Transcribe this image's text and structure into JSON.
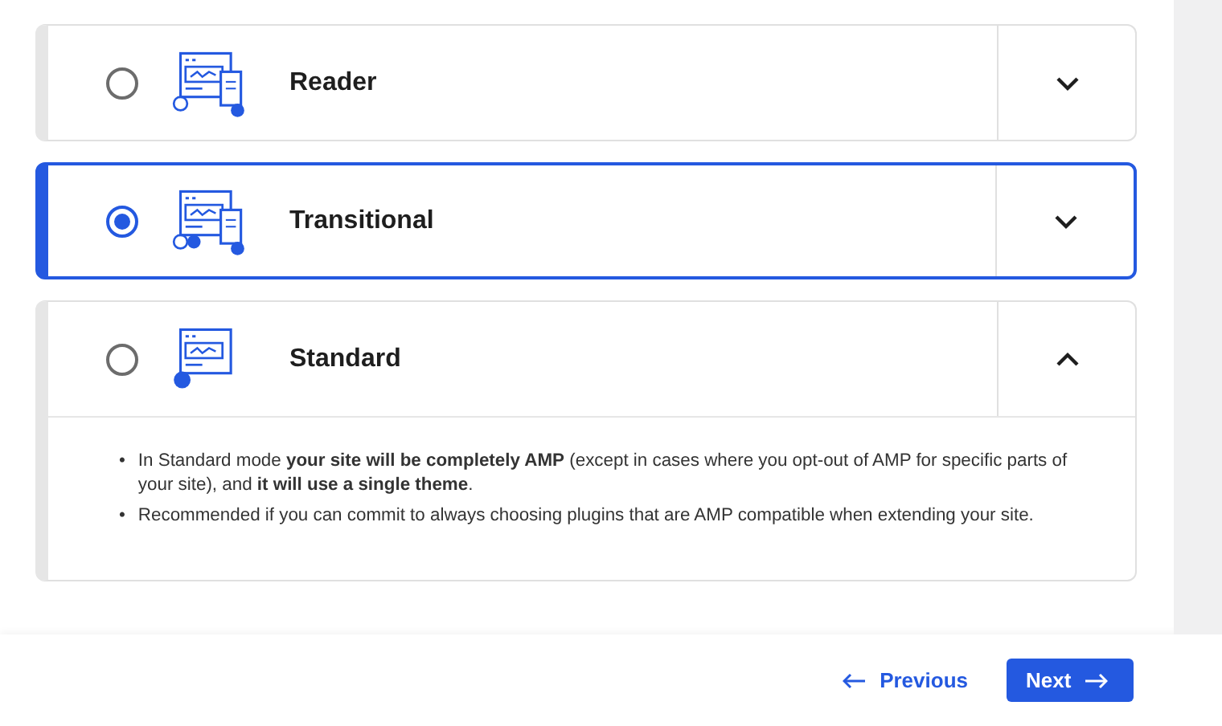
{
  "options": [
    {
      "title": "Reader",
      "selected": false,
      "expanded": false
    },
    {
      "title": "Transitional",
      "selected": true,
      "expanded": false
    },
    {
      "title": "Standard",
      "selected": false,
      "expanded": true,
      "details": [
        {
          "bullet": "•",
          "text": "In Standard mode **your site will be completely AMP** (except in cases where you opt-out of AMP for specific parts of your site), and **it will use a single theme**."
        },
        {
          "bullet": "•",
          "text": "Recommended if you can commit to always choosing plugins that are AMP compatible when extending your site."
        }
      ]
    }
  ],
  "footer": {
    "previous": "Previous",
    "next": "Next"
  }
}
